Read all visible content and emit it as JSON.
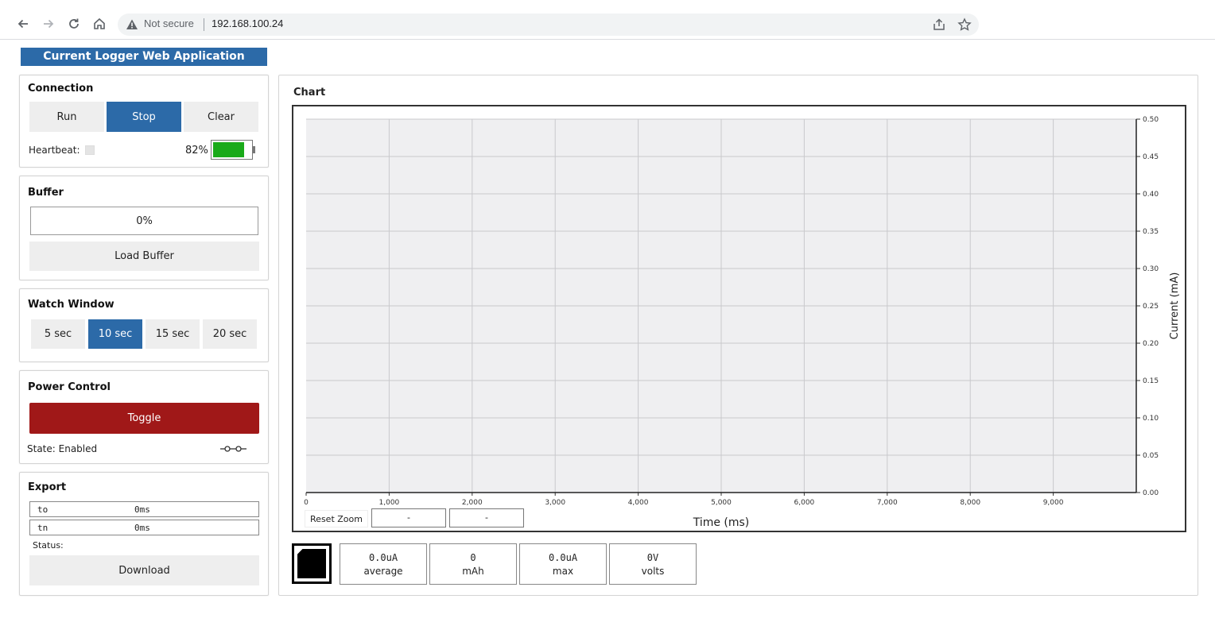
{
  "browser": {
    "security_text": "Not secure",
    "url": "192.168.100.24"
  },
  "app": {
    "title": "Current Logger Web Application"
  },
  "connection": {
    "title": "Connection",
    "run_label": "Run",
    "stop_label": "Stop",
    "clear_label": "Clear",
    "heartbeat_label": "Heartbeat:",
    "battery_percent_text": "82%",
    "battery_level": 0.82,
    "battery_color": "#1aaa1a"
  },
  "buffer": {
    "title": "Buffer",
    "progress_text": "0%",
    "load_label": "Load Buffer"
  },
  "watch_window": {
    "title": "Watch Window",
    "options": [
      "5 sec",
      "10 sec",
      "15 sec",
      "20 sec"
    ],
    "selected": "10 sec"
  },
  "power": {
    "title": "Power Control",
    "toggle_label": "Toggle",
    "state_label": "State:",
    "state_value": "Enabled",
    "toggle_color": "#a01818"
  },
  "export": {
    "title": "Export",
    "fields": [
      {
        "label": "to",
        "value": "0ms"
      },
      {
        "label": "tn",
        "value": "0ms"
      }
    ],
    "status_label": "Status:",
    "download_label": "Download"
  },
  "chart": {
    "title": "Chart",
    "reset_zoom_label": "Reset Zoom",
    "range_min": "-",
    "range_max": "-"
  },
  "chart_data": {
    "type": "line",
    "title": "",
    "xlabel": "Time (ms)",
    "ylabel": "Current (mA)",
    "xlim": [
      0,
      10000
    ],
    "ylim": [
      0,
      0.5
    ],
    "x_ticks": [
      "0",
      "1,000",
      "2,000",
      "3,000",
      "4,000",
      "5,000",
      "6,000",
      "7,000",
      "8,000",
      "9,000"
    ],
    "y_ticks": [
      "0.00",
      "0.05",
      "0.10",
      "0.15",
      "0.20",
      "0.25",
      "0.30",
      "0.35",
      "0.40",
      "0.45",
      "0.50"
    ],
    "y_axis_side": "right",
    "grid": true,
    "series": []
  },
  "stats": [
    {
      "value": "0.0uA",
      "label": "average"
    },
    {
      "value": "0",
      "label": "mAh"
    },
    {
      "value": "0.0uA",
      "label": "max"
    },
    {
      "value": "0V",
      "label": "volts"
    }
  ],
  "colors": {
    "accent": "#2c6aa8",
    "plot_background": "#efeff1",
    "grid": "#c9c9cc"
  }
}
